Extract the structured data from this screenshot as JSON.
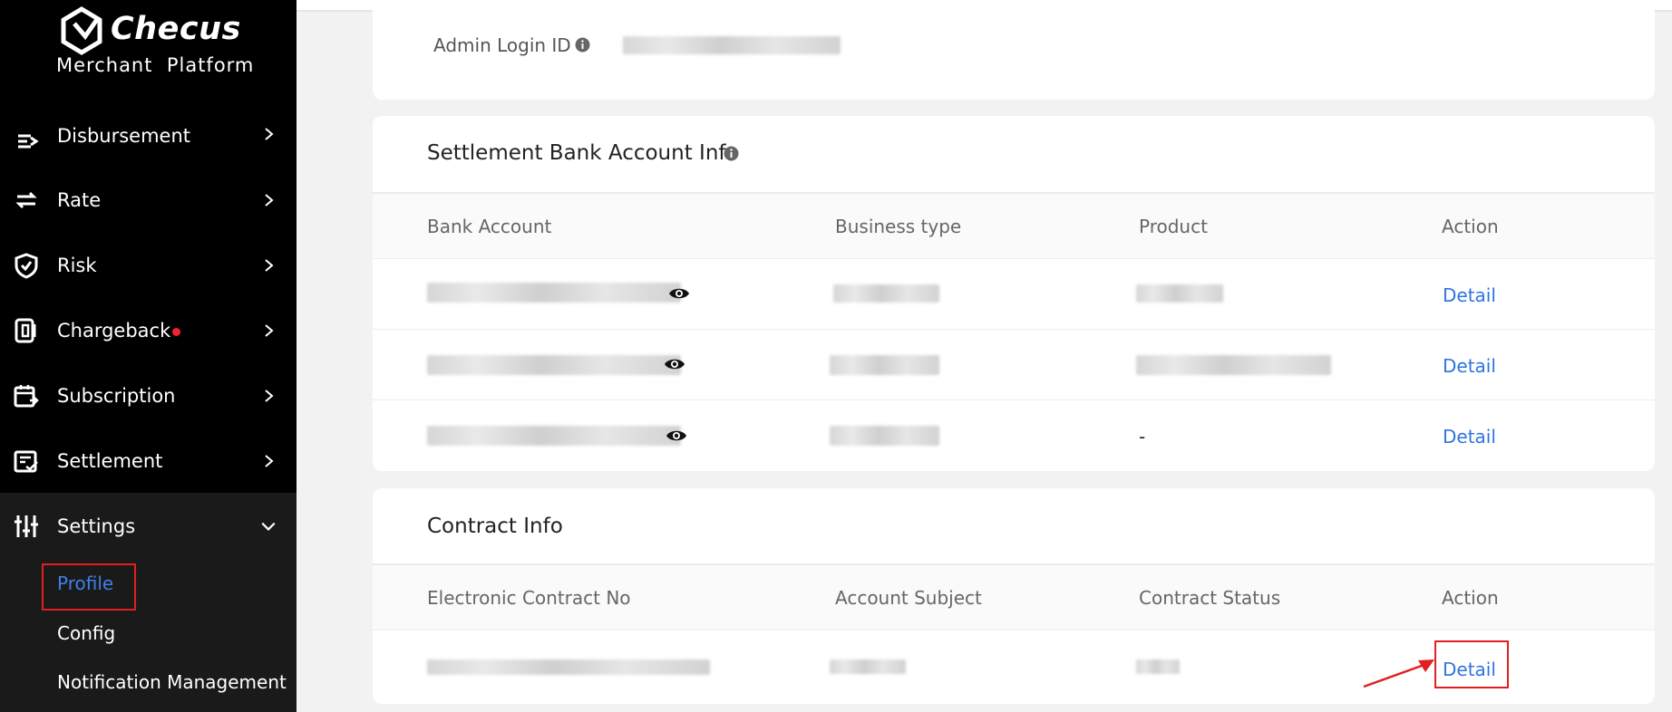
{
  "brand": {
    "name": "Checus",
    "subtitle": "Merchant  Platform"
  },
  "sidebar": {
    "items": [
      {
        "label": "Disbursement",
        "icon": "disbursement-icon"
      },
      {
        "label": "Rate",
        "icon": "exchange-icon"
      },
      {
        "label": "Risk",
        "icon": "shield-check-icon"
      },
      {
        "label": "Chargeback",
        "icon": "phone-card-icon",
        "has_dot": true
      },
      {
        "label": "Subscription",
        "icon": "calendar-icon"
      },
      {
        "label": "Settlement",
        "icon": "receipt-check-icon"
      },
      {
        "label": "Settings",
        "icon": "sliders-icon",
        "expanded": true
      }
    ],
    "sub_items": [
      {
        "label": "Profile",
        "active": true
      },
      {
        "label": "Config"
      },
      {
        "label": "Notification Management"
      }
    ]
  },
  "admin": {
    "label": "Admin Login ID"
  },
  "settlement": {
    "title": "Settlement Bank Account Info",
    "columns": [
      "Bank Account",
      "Business type",
      "Product",
      "Action"
    ],
    "rows": [
      {
        "product": "",
        "action": "Detail"
      },
      {
        "product": "",
        "action": "Detail"
      },
      {
        "product": "-",
        "action": "Detail"
      }
    ]
  },
  "contract": {
    "title": "Contract Info",
    "columns": [
      "Electronic Contract No",
      "Account Subject",
      "Contract Status",
      "Action"
    ],
    "rows": [
      {
        "action": "Detail"
      }
    ]
  },
  "colors": {
    "accent": "#2f74e0",
    "highlight": "#e02020",
    "sidebar_bg": "#000000",
    "dot": "#f5222d"
  }
}
